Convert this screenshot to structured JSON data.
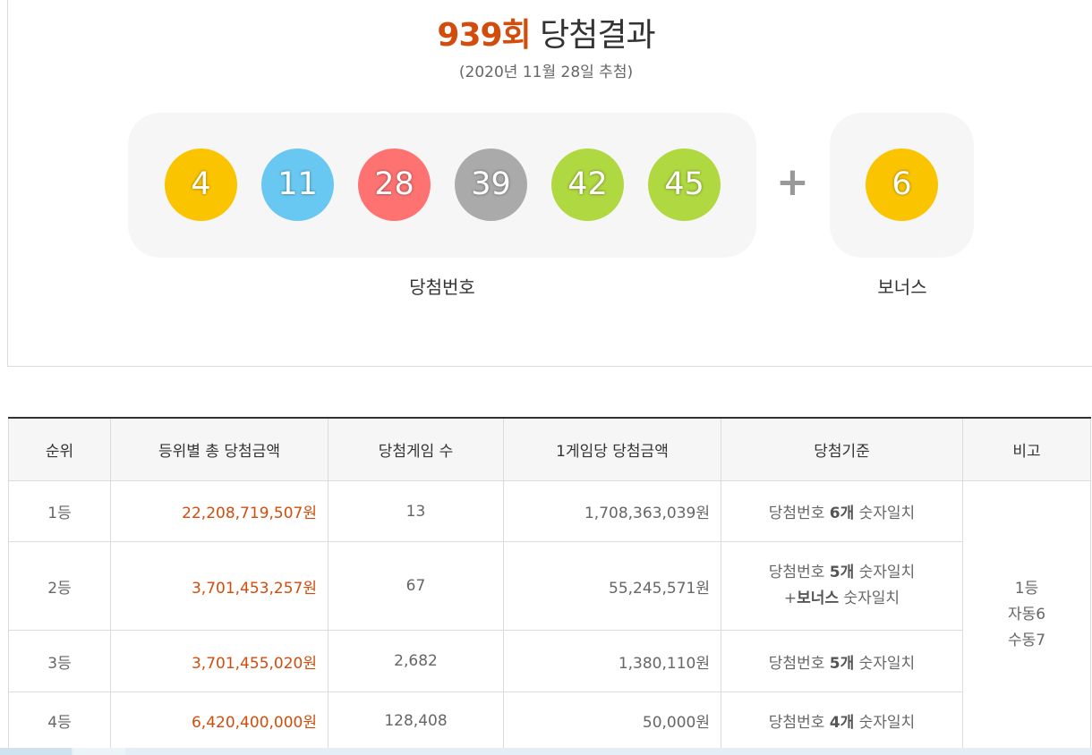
{
  "header": {
    "round": "939회",
    "title": "당첨결과",
    "date": "(2020년 11월 28일 추첨)"
  },
  "numbers": [
    {
      "value": "4",
      "color": "#fbc400"
    },
    {
      "value": "11",
      "color": "#69c8f2"
    },
    {
      "value": "28",
      "color": "#ff7272"
    },
    {
      "value": "39",
      "color": "#aaaaaa"
    },
    {
      "value": "42",
      "color": "#b0d840"
    },
    {
      "value": "45",
      "color": "#b0d840"
    }
  ],
  "plus": "+",
  "bonus": {
    "value": "6",
    "color": "#fbc400"
  },
  "labels": {
    "winning": "당첨번호",
    "bonus": "보너스"
  },
  "table": {
    "headers": [
      "순위",
      "등위별 총 당첨금액",
      "당첨게임 수",
      "1게임당 당첨금액",
      "당첨기준",
      "비고"
    ],
    "rows": [
      {
        "rank": "1등",
        "total": "22,208,719,507원",
        "games": "13",
        "per_game": "1,708,363,039원",
        "crit_pre": "당첨번호 ",
        "crit_bold": "6개",
        "crit_post": " 숫자일치"
      },
      {
        "rank": "2등",
        "total": "3,701,453,257원",
        "games": "67",
        "per_game": "55,245,571원",
        "crit_pre": "당첨번호 ",
        "crit_bold": "5개",
        "crit_post": " 숫자일치",
        "crit2_pre": "+",
        "crit2_bold": "보너스",
        "crit2_post": " 숫자일치"
      },
      {
        "rank": "3등",
        "total": "3,701,455,020원",
        "games": "2,682",
        "per_game": "1,380,110원",
        "crit_pre": "당첨번호 ",
        "crit_bold": "5개",
        "crit_post": " 숫자일치"
      },
      {
        "rank": "4등",
        "total": "6,420,400,000원",
        "games": "128,408",
        "per_game": "50,000원",
        "crit_pre": "당첨번호 ",
        "crit_bold": "4개",
        "crit_post": " 숫자일치"
      }
    ],
    "note": [
      "1등",
      "자동6",
      "수동7"
    ]
  },
  "colors": {
    "accent": "#d24d0c",
    "panel": "#f6f6f6",
    "border": "#dcdcdc"
  }
}
